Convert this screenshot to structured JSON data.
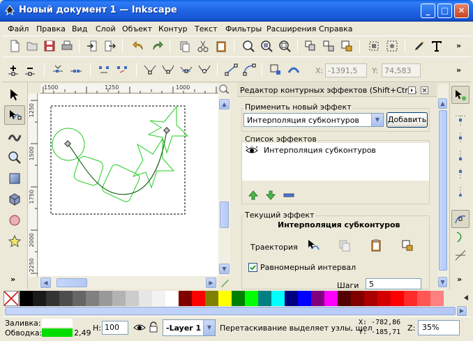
{
  "window": {
    "title": "Новый документ 1 — Inkscape",
    "buttons": {
      "minimize": "_",
      "maximize": "□",
      "close": "✕"
    }
  },
  "menu": [
    "Файл",
    "Правка",
    "Вид",
    "Слой",
    "Объект",
    "Контур",
    "Текст",
    "Фильтры",
    "Расширения",
    "Справка"
  ],
  "toolbar": {
    "overflow": "»",
    "x_label": "X:",
    "x_value": "-1391,5",
    "y_label": "Y:",
    "y_value": "74,583"
  },
  "rulers": {
    "h_labels": [
      "1500",
      "1250",
      "1000"
    ],
    "v_labels": [
      "1250",
      "1500",
      "1750",
      "2000",
      "2250"
    ]
  },
  "dock": {
    "title": "Редактор контурных эффектов (Shift+Ctrl...",
    "apply_frame_title": "Применить новый эффект",
    "effect_combo_value": "Интерполяция субконтуров",
    "add_button": "Добавить",
    "list_frame_title": "Список эффектов",
    "list_items": [
      "Интерполяция субконтуров"
    ],
    "current_frame_title": "Текущий эффект",
    "current_effect_name": "Интерполяция субконтуров",
    "trajectory_label": "Траектория",
    "equal_interval_label": "Равномерный интервал",
    "steps_label": "Шаги",
    "steps_value": "5"
  },
  "palette": {
    "colors": [
      "#000000",
      "#1a1a1a",
      "#333333",
      "#4d4d4d",
      "#666666",
      "#808080",
      "#999999",
      "#b3b3b3",
      "#cccccc",
      "#e6e6e6",
      "#f2f2f2",
      "#ffffff",
      "#800000",
      "#ff0000",
      "#808000",
      "#ffff00",
      "#008000",
      "#00ff00",
      "#008080",
      "#00ffff",
      "#000080",
      "#0000ff",
      "#800080",
      "#ff00ff",
      "#550000",
      "#800000",
      "#aa0000",
      "#d40000",
      "#ff0000",
      "#ff2a2a",
      "#ff5555",
      "#ff8080"
    ]
  },
  "status": {
    "fill_label": "Заливка:",
    "stroke_label": "Обводка:",
    "stroke_width": "2,49",
    "stroke_color": "#00dd00",
    "h_label": "Н:",
    "h_value": "100",
    "layer": "-Layer 1",
    "message": "Перетаскивание выделяет узлы, щел",
    "x_coord": "X: -782,86",
    "y_coord": "Y: -185,71",
    "zoom_label": "Z:",
    "zoom_value": "35%"
  }
}
